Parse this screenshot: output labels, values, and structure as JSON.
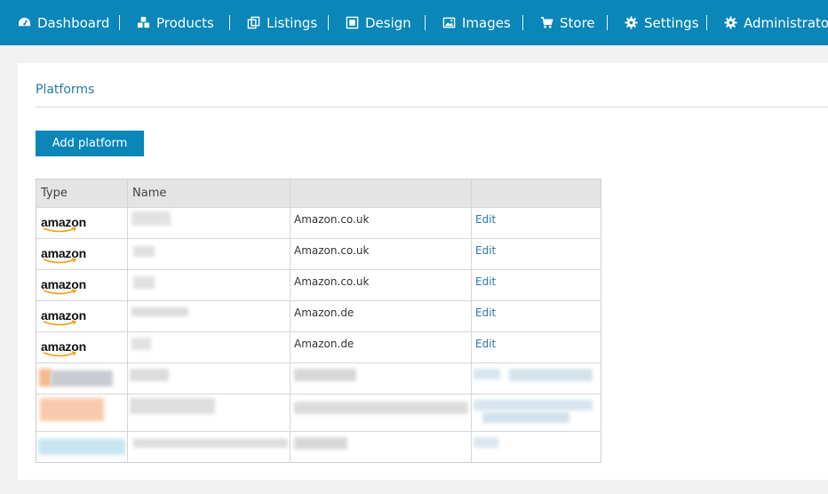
{
  "nav": {
    "items": [
      {
        "label": "Dashboard",
        "icon": "dashboard-icon"
      },
      {
        "label": "Products",
        "icon": "products-icon"
      },
      {
        "label": "Listings",
        "icon": "listings-icon"
      },
      {
        "label": "Design",
        "icon": "design-icon"
      },
      {
        "label": "Images",
        "icon": "images-icon"
      },
      {
        "label": "Store",
        "icon": "cart-icon"
      },
      {
        "label": "Settings",
        "icon": "gear-icon"
      },
      {
        "label": "Administrator",
        "icon": "gear-icon"
      }
    ]
  },
  "panel": {
    "title": "Platforms",
    "add_button": "Add platform"
  },
  "table": {
    "headers": [
      "Type",
      "Name",
      "",
      ""
    ],
    "logo_text": "amazon",
    "rows": [
      {
        "type": "amazon",
        "marketplace": "Amazon.co.uk",
        "action": "Edit"
      },
      {
        "type": "amazon",
        "marketplace": "Amazon.co.uk",
        "action": "Edit"
      },
      {
        "type": "amazon",
        "marketplace": "Amazon.co.uk",
        "action": "Edit"
      },
      {
        "type": "amazon",
        "marketplace": "Amazon.de",
        "action": "Edit"
      },
      {
        "type": "amazon",
        "marketplace": "Amazon.de",
        "action": "Edit"
      }
    ]
  },
  "colors": {
    "nav_bg": "#0a86b8",
    "accent_text": "#2a79a8",
    "table_header_bg": "#e4e4e4",
    "amazon_smile": "#f39c12"
  }
}
